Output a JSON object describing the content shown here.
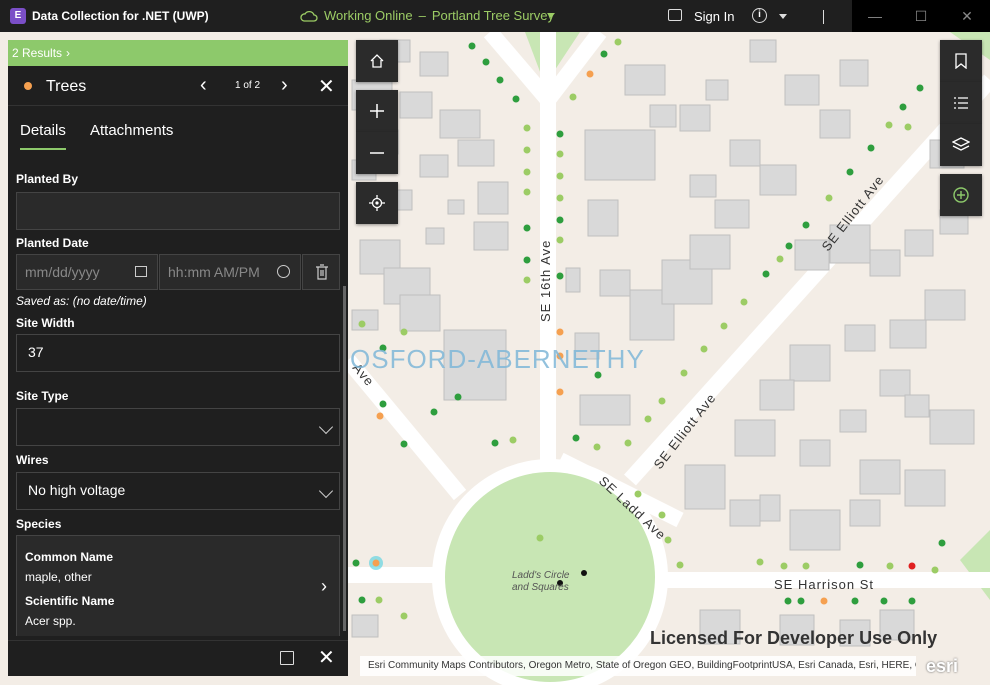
{
  "titlebar": {
    "app_title": "Data Collection for .NET  (UWP)",
    "status": "Working Online",
    "project": "Portland Tree Survey",
    "signin": "Sign In"
  },
  "panel": {
    "results": "2 Results",
    "layer_title": "Trees",
    "counter": "1 of 2",
    "tabs": [
      "Details",
      "Attachments"
    ],
    "fields": {
      "planted_by_label": "Planted By",
      "planted_by_value": "",
      "planted_date_label": "Planted Date",
      "date_placeholder": "mm/dd/yyyy",
      "time_placeholder": "hh:mm AM/PM",
      "saved_as": "Saved as: (no date/time)",
      "site_width_label": "Site Width",
      "site_width_value": "37",
      "site_type_label": "Site Type",
      "site_type_value": "",
      "wires_label": "Wires",
      "wires_value": "No high voltage",
      "species_label": "Species",
      "common_name_label": "Common Name",
      "common_name_value": "maple, other",
      "scientific_name_label": "Scientific Name",
      "scientific_name_value": "Acer spp."
    }
  },
  "map": {
    "streets": [
      "SE 16th Ave",
      "SE Elliott Ave",
      "SE Elliott Ave",
      "SE Ladd Ave",
      "SE Harrison St",
      "Ave"
    ],
    "neighborhood": "OSFORD-ABERNETHY",
    "park": [
      "Ladd's Circle",
      "and Squares"
    ],
    "watermark": "Licensed For Developer Use Only",
    "attribution": "Esri Community Maps Contributors, Oregon Metro, State of Oregon GEO, BuildingFootprintUSA, Esri Canada, Esri, HERE, Garmin, SafeGr...",
    "logo": "esri"
  },
  "colors": {
    "accent_green": "#8dc96b",
    "tree_dark_green": "#2e9e3e",
    "tree_light_green": "#9ccc65",
    "tree_orange": "#f5a050",
    "tree_red": "#e02020",
    "panel_bg": "#1f1f1f",
    "map_bg": "#f3ede6"
  }
}
